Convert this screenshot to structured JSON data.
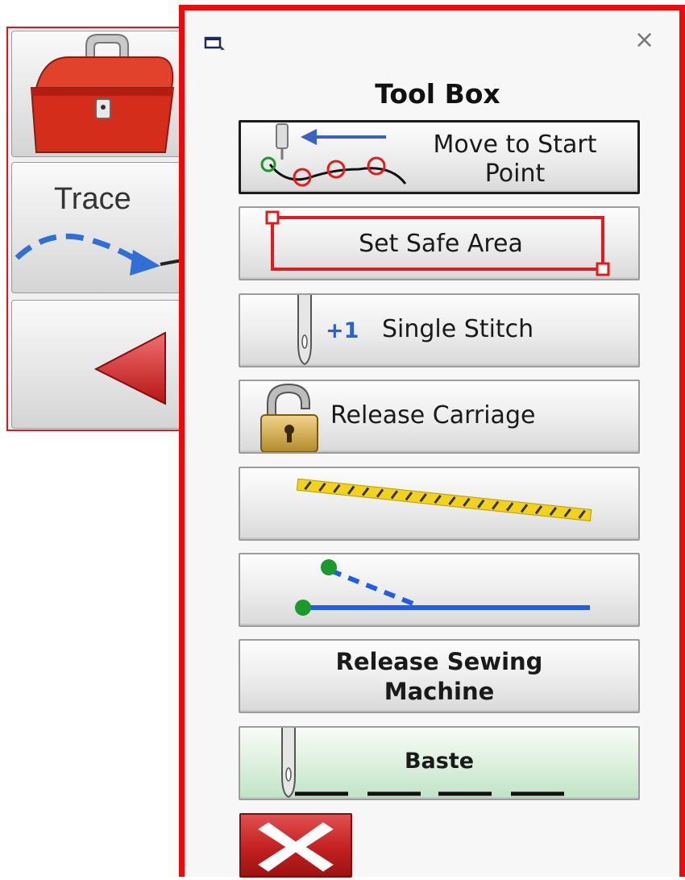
{
  "side_panel": {
    "buttons": [
      {
        "name": "toolbox",
        "icon": "toolbox-icon"
      },
      {
        "name": "trace",
        "label": "Trace",
        "icon": "trace-arrow-icon"
      },
      {
        "name": "back",
        "icon": "red-left-arrow-icon"
      }
    ]
  },
  "dialog": {
    "title": "Tool Box",
    "close_glyph": "×",
    "buttons": {
      "move_to_start": "Move to Start Point",
      "set_safe_area": "Set Safe Area",
      "single_stitch_count": "+1",
      "single_stitch": "Single Stitch",
      "release_carriage": "Release Carriage",
      "release_sewing_machine": "Release Sewing Machine",
      "baste": "Baste"
    },
    "icons": {
      "move_to_start": "needle-path-icon",
      "set_safe_area": "safe-area-rect-icon",
      "single_stitch": "needle-icon",
      "release_carriage": "padlock-icon",
      "stripe": "yellow-stripe-icon",
      "line": "green-dot-line-icon",
      "baste": "needle-icon",
      "cancel": "cancel-x-icon"
    },
    "colors": {
      "frame": "#ee0a0a",
      "accent_blue": "#2b63c8",
      "stripe_yellow": "#f2d21a",
      "dot_green": "#1a9a2a",
      "line_blue": "#1e5ee8"
    }
  }
}
